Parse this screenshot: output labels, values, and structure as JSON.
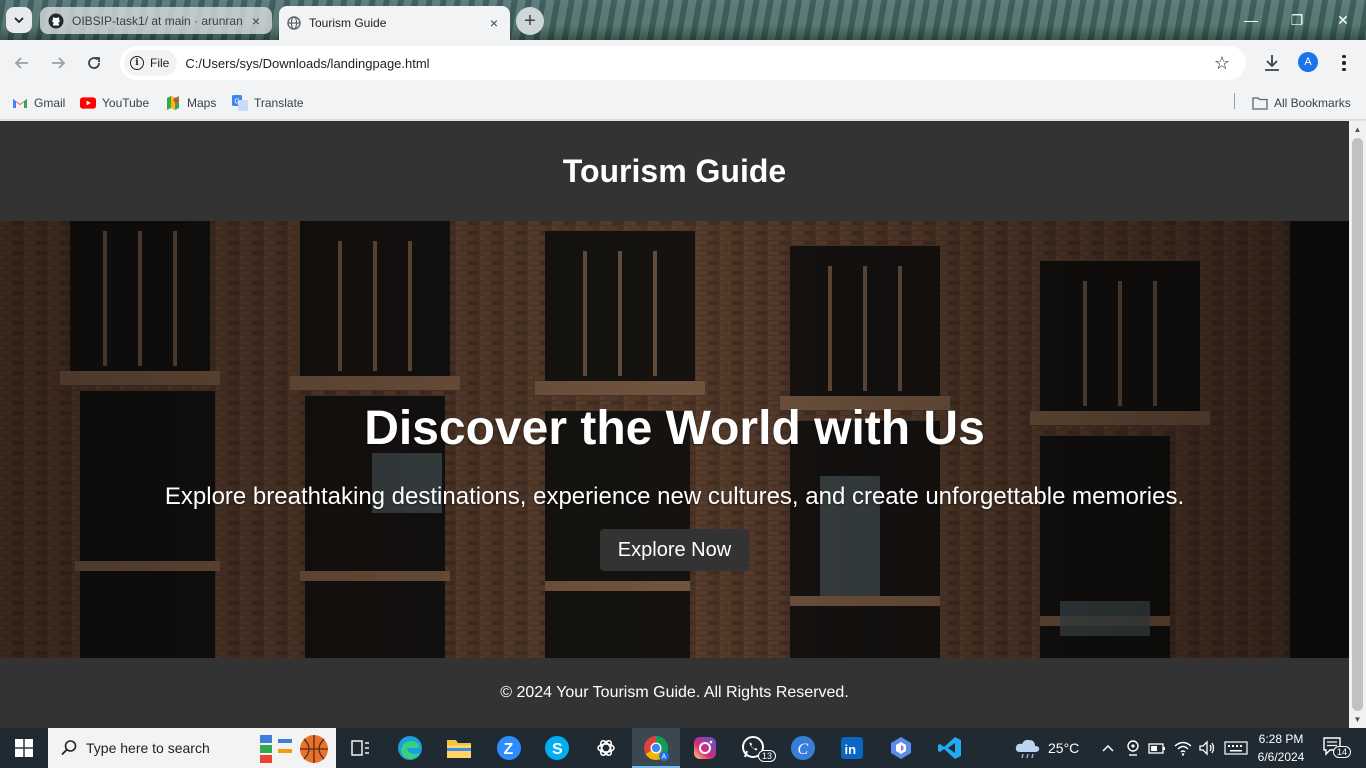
{
  "browser": {
    "tabs": [
      {
        "title": "OIBSIP-task1/ at main · arunran",
        "close": "×"
      },
      {
        "title": "Tourism Guide",
        "close": "×"
      }
    ],
    "new_tab_label": "+",
    "window_controls": {
      "minimize": "—",
      "restore": "❐",
      "close": "✕"
    },
    "omnibox": {
      "chip_label": "File",
      "url": "C:/Users/sys/Downloads/landingpage.html"
    },
    "profile_initial": "A",
    "bookmarks": [
      {
        "label": "Gmail",
        "icon": "gmail-icon"
      },
      {
        "label": "YouTube",
        "icon": "youtube-icon"
      },
      {
        "label": "Maps",
        "icon": "maps-icon"
      },
      {
        "label": "Translate",
        "icon": "translate-icon"
      }
    ],
    "all_bookmarks_label": "All Bookmarks"
  },
  "page": {
    "header_title": "Tourism Guide",
    "hero": {
      "heading": "Discover the World with Us",
      "subheading": "Explore breathtaking destinations, experience new cultures, and create unforgettable memories.",
      "cta_label": "Explore Now"
    },
    "footer_text": "© 2024 Your Tourism Guide. All Rights Reserved.",
    "colors": {
      "header_bg": "#333333",
      "text": "#ffffff",
      "button_bg": "#333333"
    }
  },
  "taskbar": {
    "search_placeholder": "Type here to search",
    "weather": "25°C",
    "time": "6:28 PM",
    "date": "6/6/2024",
    "whatsapp_badge": "13",
    "notification_badge": "14",
    "pinned_apps": [
      "task-view-icon",
      "edge-icon",
      "file-explorer-icon",
      "zoom-icon",
      "skype-icon",
      "chatgpt-icon",
      "chrome-icon",
      "instagram-icon",
      "whatsapp-icon",
      "canva-icon",
      "linkedin-icon",
      "copilot-icon",
      "vscode-icon"
    ]
  }
}
